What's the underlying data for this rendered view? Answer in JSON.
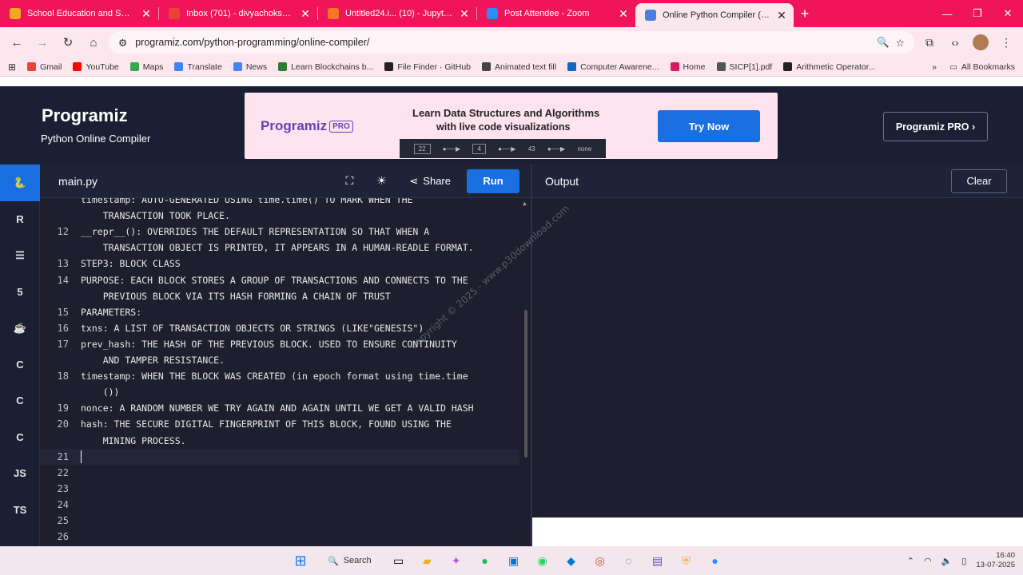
{
  "browser": {
    "tabs": [
      {
        "title": "School Education and Sport De",
        "color": "#f5a623"
      },
      {
        "title": "Inbox (701) - divyachokshi8@g",
        "color": "#ea4335"
      },
      {
        "title": "Untitled24.i... (10) - JupyterLab",
        "color": "#f37626"
      },
      {
        "title": "Post Attendee - Zoom",
        "color": "#2d8cff"
      },
      {
        "title": "Online Python Compiler (Interp",
        "color": "#4a7fe0"
      }
    ],
    "url": "programiz.com/python-programming/online-compiler/",
    "bookmarks": [
      {
        "label": "Gmail",
        "color": "#ea4335"
      },
      {
        "label": "YouTube",
        "color": "#ff0000"
      },
      {
        "label": "Maps",
        "color": "#34a853"
      },
      {
        "label": "Translate",
        "color": "#4285f4"
      },
      {
        "label": "News",
        "color": "#4285f4"
      },
      {
        "label": "Learn Blockchains b...",
        "color": "#2e7d32"
      },
      {
        "label": "File Finder · GitHub",
        "color": "#222222"
      },
      {
        "label": "Animated text fill",
        "color": "#444444"
      },
      {
        "label": "Computer Awarene...",
        "color": "#1565c0"
      },
      {
        "label": "Home",
        "color": "#d81b60"
      },
      {
        "label": "SICP[1].pdf",
        "color": "#555555"
      },
      {
        "label": "Arithmetic Operator...",
        "color": "#222222"
      }
    ],
    "all_bookmarks": "All Bookmarks"
  },
  "header": {
    "logo": "Programiz",
    "subtitle": "Python Online Compiler",
    "banner_logo": "Programiz",
    "banner_pro": "PRO",
    "banner_line1": "Learn Data Structures and Algorithms",
    "banner_line2": "with live code visualizations",
    "viz_nodes": [
      "22",
      "4",
      "43",
      "none"
    ],
    "try_now": "Try Now",
    "pro_button": "Programiz PRO ›"
  },
  "rail": [
    "python",
    "r",
    "sql",
    "html5",
    "java",
    "c",
    "cpp",
    "csharp",
    "JS",
    "TS"
  ],
  "editor": {
    "filename": "main.py",
    "share": "Share",
    "run": "Run",
    "lines": [
      {
        "n": "",
        "text": "timestamp: AUTO-GENERATED USING time.time() TO MARK WHEN THE"
      },
      {
        "n": "",
        "text": "    TRANSACTION TOOK PLACE."
      },
      {
        "n": "12",
        "text": "__repr__(): OVERRIDES THE DEFAULT REPRESENTATION SO THAT WHEN A"
      },
      {
        "n": "",
        "text": "    TRANSACTION OBJECT IS PRINTED, IT APPEARS IN A HUMAN-READLE FORMAT."
      },
      {
        "n": "13",
        "text": "STEP3: BLOCK CLASS"
      },
      {
        "n": "14",
        "text": "PURPOSE: EACH BLOCK STORES A GROUP OF TRANSACTIONS AND CONNECTS TO THE"
      },
      {
        "n": "",
        "text": "    PREVIOUS BLOCK VIA ITS HASH FORMING A CHAIN OF TRUST"
      },
      {
        "n": "15",
        "text": "PARAMETERS:"
      },
      {
        "n": "16",
        "text": "txns: A LIST OF TRANSACTION OBJECTS OR STRINGS (LIKE\"GENESIS\")"
      },
      {
        "n": "17",
        "text": "prev_hash: THE HASH OF THE PREVIOUS BLOCK. USED TO ENSURE CONTINUITY"
      },
      {
        "n": "",
        "text": "    AND TAMPER RESISTANCE."
      },
      {
        "n": "18",
        "text": "timestamp: WHEN THE BLOCK WAS CREATED (in epoch format using time.time"
      },
      {
        "n": "",
        "text": "    ())"
      },
      {
        "n": "19",
        "text": "nonce: A RANDOM NUMBER WE TRY AGAIN AND AGAIN UNTIL WE GET A VALID HASH"
      },
      {
        "n": "20",
        "text": "hash: THE SECURE DIGITAL FINGERPRINT OF THIS BLOCK, FOUND USING THE"
      },
      {
        "n": "",
        "text": "    MINING PROCESS."
      },
      {
        "n": "21",
        "text": ""
      },
      {
        "n": "22",
        "text": ""
      },
      {
        "n": "23",
        "text": ""
      },
      {
        "n": "24",
        "text": ""
      },
      {
        "n": "25",
        "text": ""
      },
      {
        "n": "26",
        "text": ""
      }
    ],
    "current_line": 16
  },
  "output": {
    "title": "Output",
    "clear": "Clear",
    "watermark": "Copyright © 2025 - www.p30download.com"
  },
  "taskbar": {
    "search": "Search",
    "time": "16:40",
    "date": "13-07-2025"
  }
}
